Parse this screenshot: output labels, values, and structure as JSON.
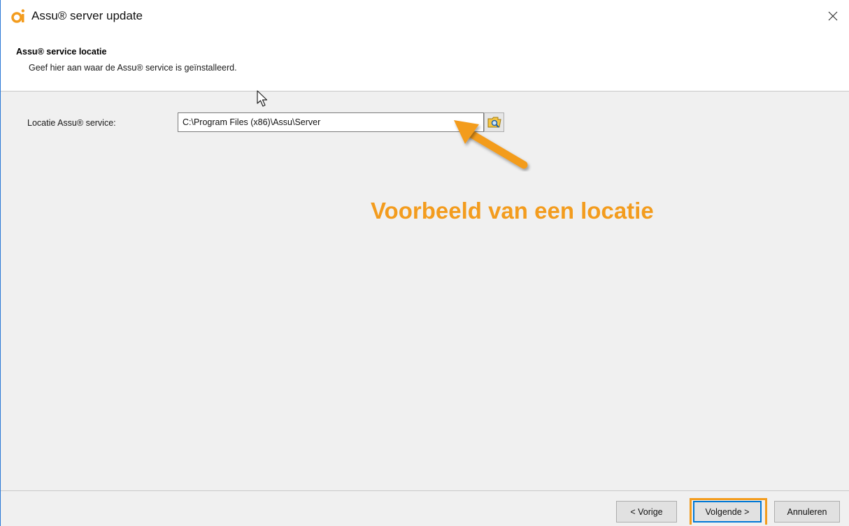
{
  "window": {
    "title": "Assu® server update",
    "accent_color": "#2b78d6",
    "icon": "assu-logo-icon"
  },
  "header": {
    "title": "Assu® service locatie",
    "subtitle": "Geef hier aan waar de Assu® service is geïnstalleerd."
  },
  "form": {
    "location_label": "Locatie Assu® service:",
    "location_value": "C:\\Program Files (x86)\\Assu\\Server",
    "browse_icon": "folder-search-icon"
  },
  "annotation": {
    "text": "Voorbeeld van een locatie",
    "color": "#f39c1e"
  },
  "footer": {
    "prev_label": "< Vorige",
    "next_label": "Volgende >",
    "cancel_label": "Annuleren"
  }
}
